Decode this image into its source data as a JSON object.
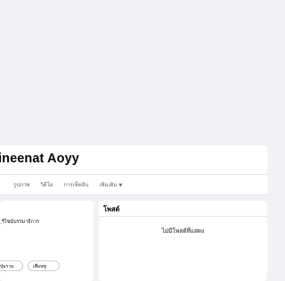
{
  "profile": {
    "name": "ineenat Aoyy"
  },
  "tabs": [
    {
      "label": "รูปภาพ"
    },
    {
      "label": "วิดีโอ"
    },
    {
      "label": "การเช็คอิน"
    },
    {
      "label": "เพิ่มเติม",
      "icon": "caret-down-icon"
    }
  ],
  "left": {
    "text": "ุรีไซม์บรรมาธิการ",
    "buttons": [
      "ปุ่มรวม",
      "เพื่อนซู"
    ]
  },
  "posts": {
    "title": "โพสต์",
    "empty_message": "ไม่มีโพสต์ที่แสดง"
  },
  "colors": {
    "page_bg": "#f0f2f5",
    "card_bg": "#ffffff",
    "muted_text": "#65676b"
  }
}
